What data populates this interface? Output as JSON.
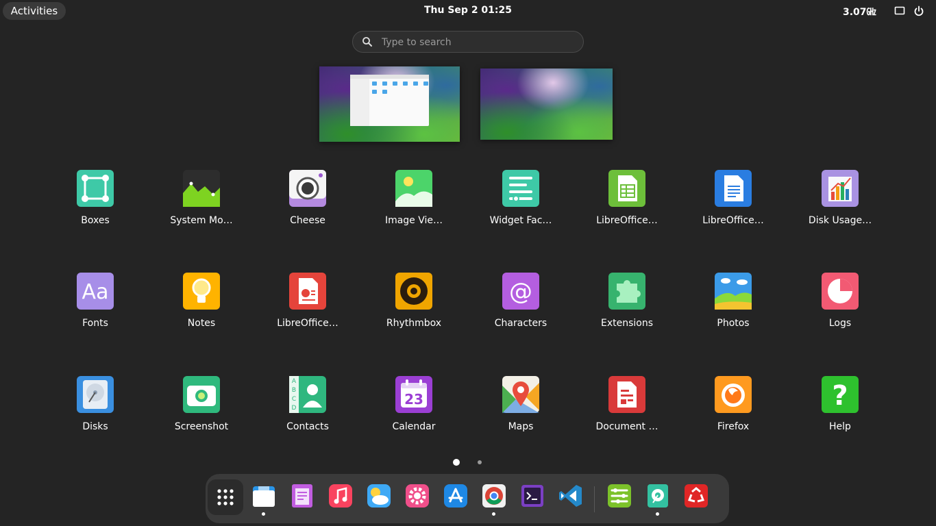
{
  "topbar": {
    "activities": "Activities",
    "clock": "Thu Sep 2  01:25",
    "cpu": "3.07㎓"
  },
  "search": {
    "placeholder": "Type to search"
  },
  "apps": [
    {
      "label": "Boxes"
    },
    {
      "label": "System Mo…"
    },
    {
      "label": "Cheese"
    },
    {
      "label": "Image Vie…"
    },
    {
      "label": "Widget Fac…"
    },
    {
      "label": "LibreOffice…"
    },
    {
      "label": "LibreOffice…"
    },
    {
      "label": "Disk Usage…"
    },
    {
      "label": "Fonts"
    },
    {
      "label": "Notes"
    },
    {
      "label": "LibreOffice…"
    },
    {
      "label": "Rhythmbox"
    },
    {
      "label": "Characters"
    },
    {
      "label": "Extensions"
    },
    {
      "label": "Photos"
    },
    {
      "label": "Logs"
    },
    {
      "label": "Disks"
    },
    {
      "label": "Screenshot"
    },
    {
      "label": "Contacts"
    },
    {
      "label": "Calendar"
    },
    {
      "label": "Maps"
    },
    {
      "label": "Document …"
    },
    {
      "label": "Firefox"
    },
    {
      "label": "Help"
    }
  ],
  "calendar_day": "23",
  "pages": {
    "current": 1,
    "total": 2
  },
  "colors": {
    "background": "#242424",
    "accent": "#ffffff"
  }
}
